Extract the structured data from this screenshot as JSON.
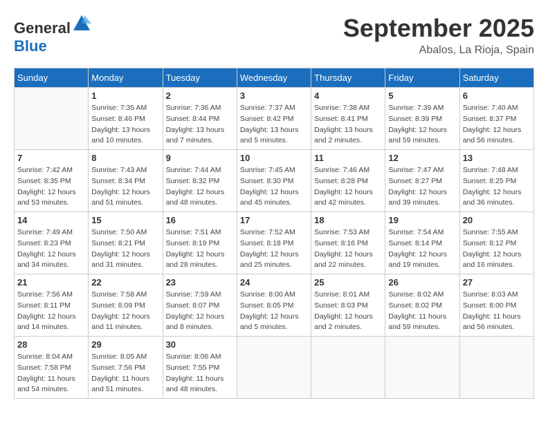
{
  "header": {
    "logo_general": "General",
    "logo_blue": "Blue",
    "month": "September 2025",
    "location": "Abalos, La Rioja, Spain"
  },
  "weekdays": [
    "Sunday",
    "Monday",
    "Tuesday",
    "Wednesday",
    "Thursday",
    "Friday",
    "Saturday"
  ],
  "weeks": [
    [
      {
        "day": "",
        "info": ""
      },
      {
        "day": "1",
        "info": "Sunrise: 7:35 AM\nSunset: 8:46 PM\nDaylight: 13 hours\nand 10 minutes."
      },
      {
        "day": "2",
        "info": "Sunrise: 7:36 AM\nSunset: 8:44 PM\nDaylight: 13 hours\nand 7 minutes."
      },
      {
        "day": "3",
        "info": "Sunrise: 7:37 AM\nSunset: 8:42 PM\nDaylight: 13 hours\nand 5 minutes."
      },
      {
        "day": "4",
        "info": "Sunrise: 7:38 AM\nSunset: 8:41 PM\nDaylight: 13 hours\nand 2 minutes."
      },
      {
        "day": "5",
        "info": "Sunrise: 7:39 AM\nSunset: 8:39 PM\nDaylight: 12 hours\nand 59 minutes."
      },
      {
        "day": "6",
        "info": "Sunrise: 7:40 AM\nSunset: 8:37 PM\nDaylight: 12 hours\nand 56 minutes."
      }
    ],
    [
      {
        "day": "7",
        "info": "Sunrise: 7:42 AM\nSunset: 8:35 PM\nDaylight: 12 hours\nand 53 minutes."
      },
      {
        "day": "8",
        "info": "Sunrise: 7:43 AM\nSunset: 8:34 PM\nDaylight: 12 hours\nand 51 minutes."
      },
      {
        "day": "9",
        "info": "Sunrise: 7:44 AM\nSunset: 8:32 PM\nDaylight: 12 hours\nand 48 minutes."
      },
      {
        "day": "10",
        "info": "Sunrise: 7:45 AM\nSunset: 8:30 PM\nDaylight: 12 hours\nand 45 minutes."
      },
      {
        "day": "11",
        "info": "Sunrise: 7:46 AM\nSunset: 8:28 PM\nDaylight: 12 hours\nand 42 minutes."
      },
      {
        "day": "12",
        "info": "Sunrise: 7:47 AM\nSunset: 8:27 PM\nDaylight: 12 hours\nand 39 minutes."
      },
      {
        "day": "13",
        "info": "Sunrise: 7:48 AM\nSunset: 8:25 PM\nDaylight: 12 hours\nand 36 minutes."
      }
    ],
    [
      {
        "day": "14",
        "info": "Sunrise: 7:49 AM\nSunset: 8:23 PM\nDaylight: 12 hours\nand 34 minutes."
      },
      {
        "day": "15",
        "info": "Sunrise: 7:50 AM\nSunset: 8:21 PM\nDaylight: 12 hours\nand 31 minutes."
      },
      {
        "day": "16",
        "info": "Sunrise: 7:51 AM\nSunset: 8:19 PM\nDaylight: 12 hours\nand 28 minutes."
      },
      {
        "day": "17",
        "info": "Sunrise: 7:52 AM\nSunset: 8:18 PM\nDaylight: 12 hours\nand 25 minutes."
      },
      {
        "day": "18",
        "info": "Sunrise: 7:53 AM\nSunset: 8:16 PM\nDaylight: 12 hours\nand 22 minutes."
      },
      {
        "day": "19",
        "info": "Sunrise: 7:54 AM\nSunset: 8:14 PM\nDaylight: 12 hours\nand 19 minutes."
      },
      {
        "day": "20",
        "info": "Sunrise: 7:55 AM\nSunset: 8:12 PM\nDaylight: 12 hours\nand 16 minutes."
      }
    ],
    [
      {
        "day": "21",
        "info": "Sunrise: 7:56 AM\nSunset: 8:11 PM\nDaylight: 12 hours\nand 14 minutes."
      },
      {
        "day": "22",
        "info": "Sunrise: 7:58 AM\nSunset: 8:09 PM\nDaylight: 12 hours\nand 11 minutes."
      },
      {
        "day": "23",
        "info": "Sunrise: 7:59 AM\nSunset: 8:07 PM\nDaylight: 12 hours\nand 8 minutes."
      },
      {
        "day": "24",
        "info": "Sunrise: 8:00 AM\nSunset: 8:05 PM\nDaylight: 12 hours\nand 5 minutes."
      },
      {
        "day": "25",
        "info": "Sunrise: 8:01 AM\nSunset: 8:03 PM\nDaylight: 12 hours\nand 2 minutes."
      },
      {
        "day": "26",
        "info": "Sunrise: 8:02 AM\nSunset: 8:02 PM\nDaylight: 11 hours\nand 59 minutes."
      },
      {
        "day": "27",
        "info": "Sunrise: 8:03 AM\nSunset: 8:00 PM\nDaylight: 11 hours\nand 56 minutes."
      }
    ],
    [
      {
        "day": "28",
        "info": "Sunrise: 8:04 AM\nSunset: 7:58 PM\nDaylight: 11 hours\nand 54 minutes."
      },
      {
        "day": "29",
        "info": "Sunrise: 8:05 AM\nSunset: 7:56 PM\nDaylight: 11 hours\nand 51 minutes."
      },
      {
        "day": "30",
        "info": "Sunrise: 8:06 AM\nSunset: 7:55 PM\nDaylight: 11 hours\nand 48 minutes."
      },
      {
        "day": "",
        "info": ""
      },
      {
        "day": "",
        "info": ""
      },
      {
        "day": "",
        "info": ""
      },
      {
        "day": "",
        "info": ""
      }
    ]
  ]
}
